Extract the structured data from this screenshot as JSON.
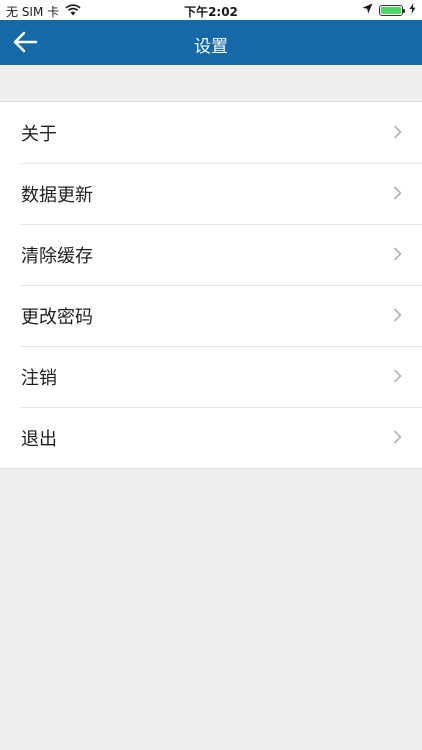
{
  "status_bar": {
    "carrier": "无 SIM 卡",
    "time": "下午2:02",
    "icons": [
      "wifi-icon",
      "location-arrow-icon",
      "battery-icon",
      "charging-bolt-icon"
    ],
    "battery_level": 1.0,
    "battery_color": "#4cd964"
  },
  "nav": {
    "title": "设置",
    "back_icon": "back-arrow-icon",
    "background": "#1569a8"
  },
  "menu": {
    "items": [
      {
        "label": "关于",
        "icon": "chevron-right-icon"
      },
      {
        "label": "数据更新",
        "icon": "chevron-right-icon"
      },
      {
        "label": "清除缓存",
        "icon": "chevron-right-icon"
      },
      {
        "label": "更改密码",
        "icon": "chevron-right-icon"
      },
      {
        "label": "注销",
        "icon": "chevron-right-icon"
      },
      {
        "label": "退出",
        "icon": "chevron-right-icon"
      }
    ]
  }
}
